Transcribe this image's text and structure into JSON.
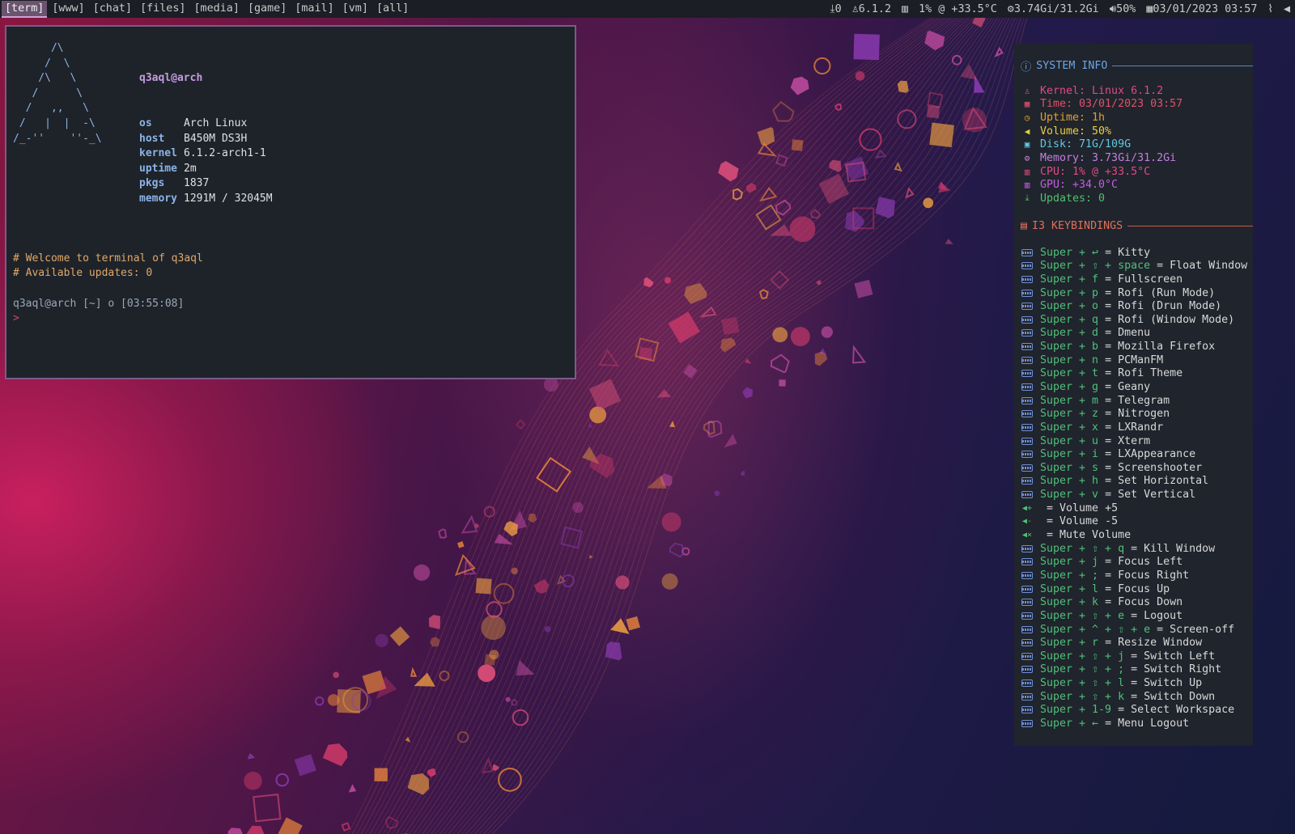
{
  "topbar": {
    "workspaces": [
      "[term]",
      "[www]",
      "[chat]",
      "[files]",
      "[media]",
      "[game]",
      "[mail]",
      "[vm]",
      "[all]"
    ],
    "active_workspace": "[term]",
    "updates": "0",
    "kernel": "6.1.2",
    "cpu": "1% @ +33.5°C",
    "memory": "3.74Gi/31.2Gi",
    "volume": "50%",
    "datetime": "03/01/2023 03:57",
    "icons": [
      "download-icon",
      "tux-icon",
      "chip-icon",
      "gear-icon",
      "speaker-icon",
      "calendar-icon",
      "paperclip-icon",
      "speaker-icon"
    ]
  },
  "terminal": {
    "ascii_art": [
      "      /\\",
      "     /  \\",
      "    /\\   \\",
      "   /      \\",
      "  /   ,,   \\",
      " /   |  |  -\\",
      "/_-''    ''-_\\"
    ],
    "userhost": "q3aql@arch",
    "info": [
      {
        "key": "os",
        "value": "Arch Linux"
      },
      {
        "key": "host",
        "value": "B450M DS3H"
      },
      {
        "key": "kernel",
        "value": "6.1.2-arch1-1"
      },
      {
        "key": "uptime",
        "value": "2m"
      },
      {
        "key": "pkgs",
        "value": "1837"
      },
      {
        "key": "memory",
        "value": "1291M / 32045M"
      }
    ],
    "comment1": "# Welcome to terminal of q3aql",
    "comment2": "# Available updates: 0",
    "prompt": "q3aql@arch [~] o [03:55:08]",
    "cursor": ">"
  },
  "sidebar": {
    "system_title": "SYSTEM INFO",
    "system": [
      {
        "icon": "tux-icon",
        "text": "Kernel: Linux 6.1.2",
        "color": "#e04a86"
      },
      {
        "icon": "calendar-icon",
        "text": "Time: 03/01/2023 03:57",
        "color": "#e0506a"
      },
      {
        "icon": "clock-icon",
        "text": "Uptime: 1h",
        "color": "#e0a030"
      },
      {
        "icon": "speaker-icon",
        "text": "Volume: 50%",
        "color": "#e8d040"
      },
      {
        "icon": "disk-icon",
        "text": "Disk: 71G/109G",
        "color": "#60c8e0"
      },
      {
        "icon": "memory-icon",
        "text": "Memory: 3.73Gi/31.2Gi",
        "color": "#c080e0"
      },
      {
        "icon": "cpu-icon",
        "text": "CPU:  1% @ +33.5°C",
        "color": "#e04a86"
      },
      {
        "icon": "gpu-icon",
        "text": "GPU: +34.0°C",
        "color": "#c060e0"
      },
      {
        "icon": "download-icon",
        "text": "Updates: 0",
        "color": "#50c070"
      }
    ],
    "kb_title": "I3 KEYBINDINGS",
    "keybindings": [
      {
        "icon": "keyboard-icon",
        "keys": "Super + ↩ ",
        "action": "= Kitty"
      },
      {
        "icon": "keyboard-icon",
        "keys": "Super + ⇧ + space ",
        "action": "= Float Window"
      },
      {
        "icon": "keyboard-icon",
        "keys": "Super + f ",
        "action": "= Fullscreen"
      },
      {
        "icon": "keyboard-icon",
        "keys": "Super + p ",
        "action": "= Rofi (Run Mode)"
      },
      {
        "icon": "keyboard-icon",
        "keys": "Super + o ",
        "action": "= Rofi (Drun Mode)"
      },
      {
        "icon": "keyboard-icon",
        "keys": "Super + q ",
        "action": "= Rofi (Window Mode)"
      },
      {
        "icon": "keyboard-icon",
        "keys": "Super + d ",
        "action": "= Dmenu"
      },
      {
        "icon": "keyboard-icon",
        "keys": "Super + b ",
        "action": "= Mozilla Firefox"
      },
      {
        "icon": "keyboard-icon",
        "keys": "Super + n ",
        "action": "= PCManFM"
      },
      {
        "icon": "keyboard-icon",
        "keys": "Super + t ",
        "action": "= Rofi Theme"
      },
      {
        "icon": "keyboard-icon",
        "keys": "Super + g ",
        "action": "= Geany"
      },
      {
        "icon": "keyboard-icon",
        "keys": "Super + m ",
        "action": "= Telegram"
      },
      {
        "icon": "keyboard-icon",
        "keys": "Super + z ",
        "action": "= Nitrogen"
      },
      {
        "icon": "keyboard-icon",
        "keys": "Super + x ",
        "action": "= LXRandr"
      },
      {
        "icon": "keyboard-icon",
        "keys": "Super + u ",
        "action": "= Xterm"
      },
      {
        "icon": "keyboard-icon",
        "keys": "Super + i ",
        "action": "= LXAppearance"
      },
      {
        "icon": "keyboard-icon",
        "keys": "Super + s ",
        "action": "= Screenshooter"
      },
      {
        "icon": "keyboard-icon",
        "keys": "Super + h ",
        "action": "= Set Horizontal"
      },
      {
        "icon": "keyboard-icon",
        "keys": "Super + v ",
        "action": "= Set Vertical"
      },
      {
        "icon": "volume-up-icon",
        "keys": " ",
        "action": "= Volume +5"
      },
      {
        "icon": "volume-down-icon",
        "keys": " ",
        "action": "= Volume -5"
      },
      {
        "icon": "volume-mute-icon",
        "keys": " ",
        "action": "= Mute Volume"
      },
      {
        "icon": "keyboard-icon",
        "keys": "Super + ⇧ + q ",
        "action": "= Kill Window"
      },
      {
        "icon": "keyboard-icon",
        "keys": "Super + j ",
        "action": "= Focus Left"
      },
      {
        "icon": "keyboard-icon",
        "keys": "Super + ; ",
        "action": "= Focus Right"
      },
      {
        "icon": "keyboard-icon",
        "keys": "Super + l ",
        "action": "= Focus Up"
      },
      {
        "icon": "keyboard-icon",
        "keys": "Super + k ",
        "action": "= Focus Down"
      },
      {
        "icon": "keyboard-icon",
        "keys": "Super + ⇧ + e ",
        "action": "= Logout"
      },
      {
        "icon": "keyboard-icon",
        "keys": "Super + ^ + ⇧ + e ",
        "action": "= Screen-off"
      },
      {
        "icon": "keyboard-icon",
        "keys": "Super + r ",
        "action": "= Resize Window"
      },
      {
        "icon": "keyboard-icon",
        "keys": "Super + ⇧ + j ",
        "action": "= Switch Left"
      },
      {
        "icon": "keyboard-icon",
        "keys": "Super + ⇧ + ; ",
        "action": "= Switch Right"
      },
      {
        "icon": "keyboard-icon",
        "keys": "Super + ⇧ + l ",
        "action": "= Switch Up"
      },
      {
        "icon": "keyboard-icon",
        "keys": "Super + ⇧ + k ",
        "action": "= Switch Down"
      },
      {
        "icon": "keyboard-icon",
        "keys": "Super + 1-9 ",
        "action": "= Select Workspace"
      },
      {
        "icon": "keyboard-icon",
        "keys": "Super + ← ",
        "action": "= Menu Logout"
      }
    ]
  }
}
